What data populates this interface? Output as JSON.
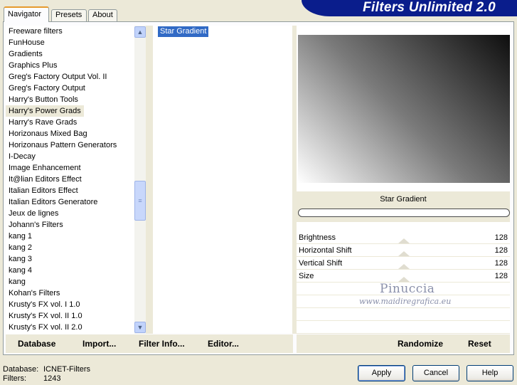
{
  "banner": {
    "title": "Filters Unlimited 2.0"
  },
  "tabs": [
    {
      "label": "Navigator",
      "active": true
    },
    {
      "label": "Presets",
      "active": false
    },
    {
      "label": "About",
      "active": false
    }
  ],
  "categories": [
    "Freeware filters",
    "FunHouse",
    "Gradients",
    "Graphics Plus",
    "Greg's Factory Output Vol. II",
    "Greg's Factory Output",
    "Harry's Button Tools",
    "Harry's Power Grads",
    "Harry's Rave Grads",
    "Horizonaus Mixed Bag",
    "Horizonaus Pattern Generators",
    "I-Decay",
    "Image Enhancement",
    "It@lian Editors Effect",
    "Italian Editors Effect",
    "Italian Editors Generatore",
    "Jeux de lignes",
    "Johann's Filters",
    "kang 1",
    "kang 2",
    "kang 3",
    "kang 4",
    "kang",
    "Kohan's Filters",
    "Krusty's FX vol. I 1.0",
    "Krusty's FX vol. II 1.0",
    "Krusty's FX vol. II 2.0"
  ],
  "selected_category": "Harry's Power Grads",
  "filters": [
    "Star Gradient"
  ],
  "preview": {
    "filter_name": "Star Gradient"
  },
  "params": [
    {
      "label": "Brightness",
      "value": "128"
    },
    {
      "label": "Horizontal Shift",
      "value": "128"
    },
    {
      "label": "Vertical Shift",
      "value": "128"
    },
    {
      "label": "Size",
      "value": "128"
    }
  ],
  "watermark": {
    "line1": "Pinuccia",
    "line2": "www.maidiregrafica.eu"
  },
  "left_buttons": {
    "database": "Database",
    "import": "Import...",
    "filter_info": "Filter Info...",
    "editor": "Editor..."
  },
  "right_buttons": {
    "randomize": "Randomize",
    "reset": "Reset"
  },
  "info": {
    "database_label": "Database:",
    "database_value": "ICNET-Filters",
    "filters_label": "Filters:",
    "filters_value": "1243"
  },
  "dialog_buttons": {
    "apply": "Apply",
    "cancel": "Cancel",
    "help": "Help"
  }
}
